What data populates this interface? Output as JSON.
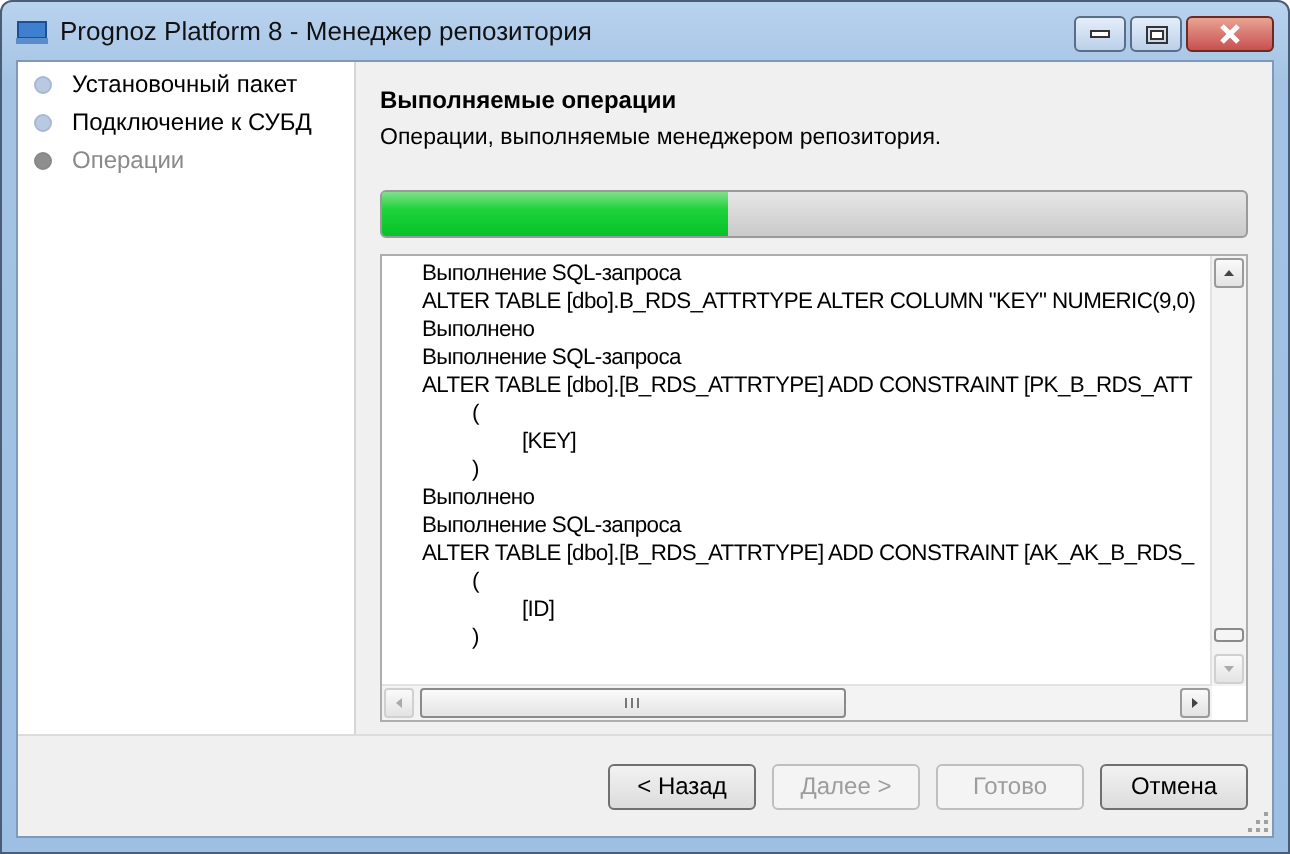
{
  "window": {
    "title": "Prognoz Platform 8 - Менеджер репозитория"
  },
  "steps": [
    {
      "label": "Установочный пакет",
      "selected": false
    },
    {
      "label": "Подключение к СУБД",
      "selected": false
    },
    {
      "label": "Операции",
      "selected": true
    }
  ],
  "header": {
    "title": "Выполняемые операции",
    "subtitle": "Операции, выполняемые менеджером репозитория."
  },
  "progress": {
    "level": 0.4
  },
  "log": [
    {
      "text": "Выполнение SQL-запроса"
    },
    {
      "text": "ALTER TABLE [dbo].B_RDS_ATTRTYPE ALTER COLUMN \"KEY\" NUMERIC(9,0)"
    },
    {
      "text": "Выполнено"
    },
    {
      "text": "Выполнение SQL-запроса"
    },
    {
      "text": "ALTER TABLE [dbo].[B_RDS_ATTRTYPE] ADD CONSTRAINT [PK_B_RDS_ATT",
      "children": [
        {
          "text": "(",
          "children": [
            {
              "text": "[KEY]"
            }
          ]
        },
        {
          "text": ")"
        }
      ]
    },
    {
      "text": "Выполнено"
    },
    {
      "text": "Выполнение SQL-запроса"
    },
    {
      "text": "ALTER TABLE [dbo].[B_RDS_ATTRTYPE] ADD CONSTRAINT [AK_AK_B_RDS_",
      "children": [
        {
          "text": "(",
          "children": [
            {
              "text": "[ID]"
            }
          ]
        },
        {
          "text": ")"
        }
      ]
    }
  ],
  "buttons": [
    {
      "label": "< Назад",
      "disabled": false
    },
    {
      "label": "Далее >",
      "disabled": true
    },
    {
      "label": "Готово",
      "disabled": true
    },
    {
      "label": "Отмена",
      "disabled": false
    }
  ]
}
